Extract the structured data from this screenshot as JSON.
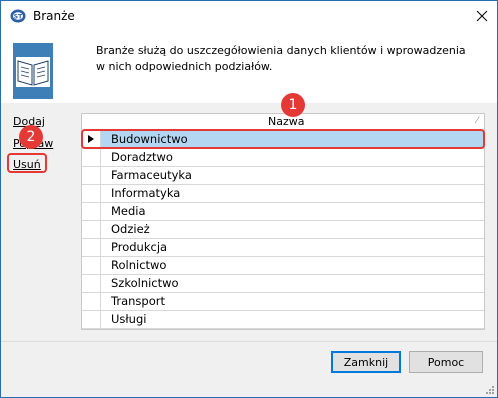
{
  "window": {
    "title": "Branże",
    "close_glyph": "✕"
  },
  "header": {
    "description": "Branże służą do uszczegółowienia danych klientów i wprowadzenia w nich odpowiednich podziałów."
  },
  "sidebar": {
    "add_label": "Dodaj",
    "edit_label": "Popraw",
    "delete_label": "Usuń"
  },
  "grid": {
    "column_header": "Nazwa",
    "rows": [
      "Budownictwo",
      "Doradztwo",
      "Farmaceutyka",
      "Informatyka",
      "Media",
      "Odzież",
      "Produkcja",
      "Rolnictwo",
      "Szkolnictwo",
      "Transport",
      "Usługi"
    ],
    "selected_index": 0
  },
  "buttons": {
    "close_label": "Zamknij",
    "help_label": "Pomoc"
  },
  "annotations": {
    "badge_1": "1",
    "badge_2": "2",
    "color": "#e53935"
  },
  "icons": {
    "app": "app-logo-icon",
    "header": "open-book-icon",
    "close": "close-icon"
  }
}
